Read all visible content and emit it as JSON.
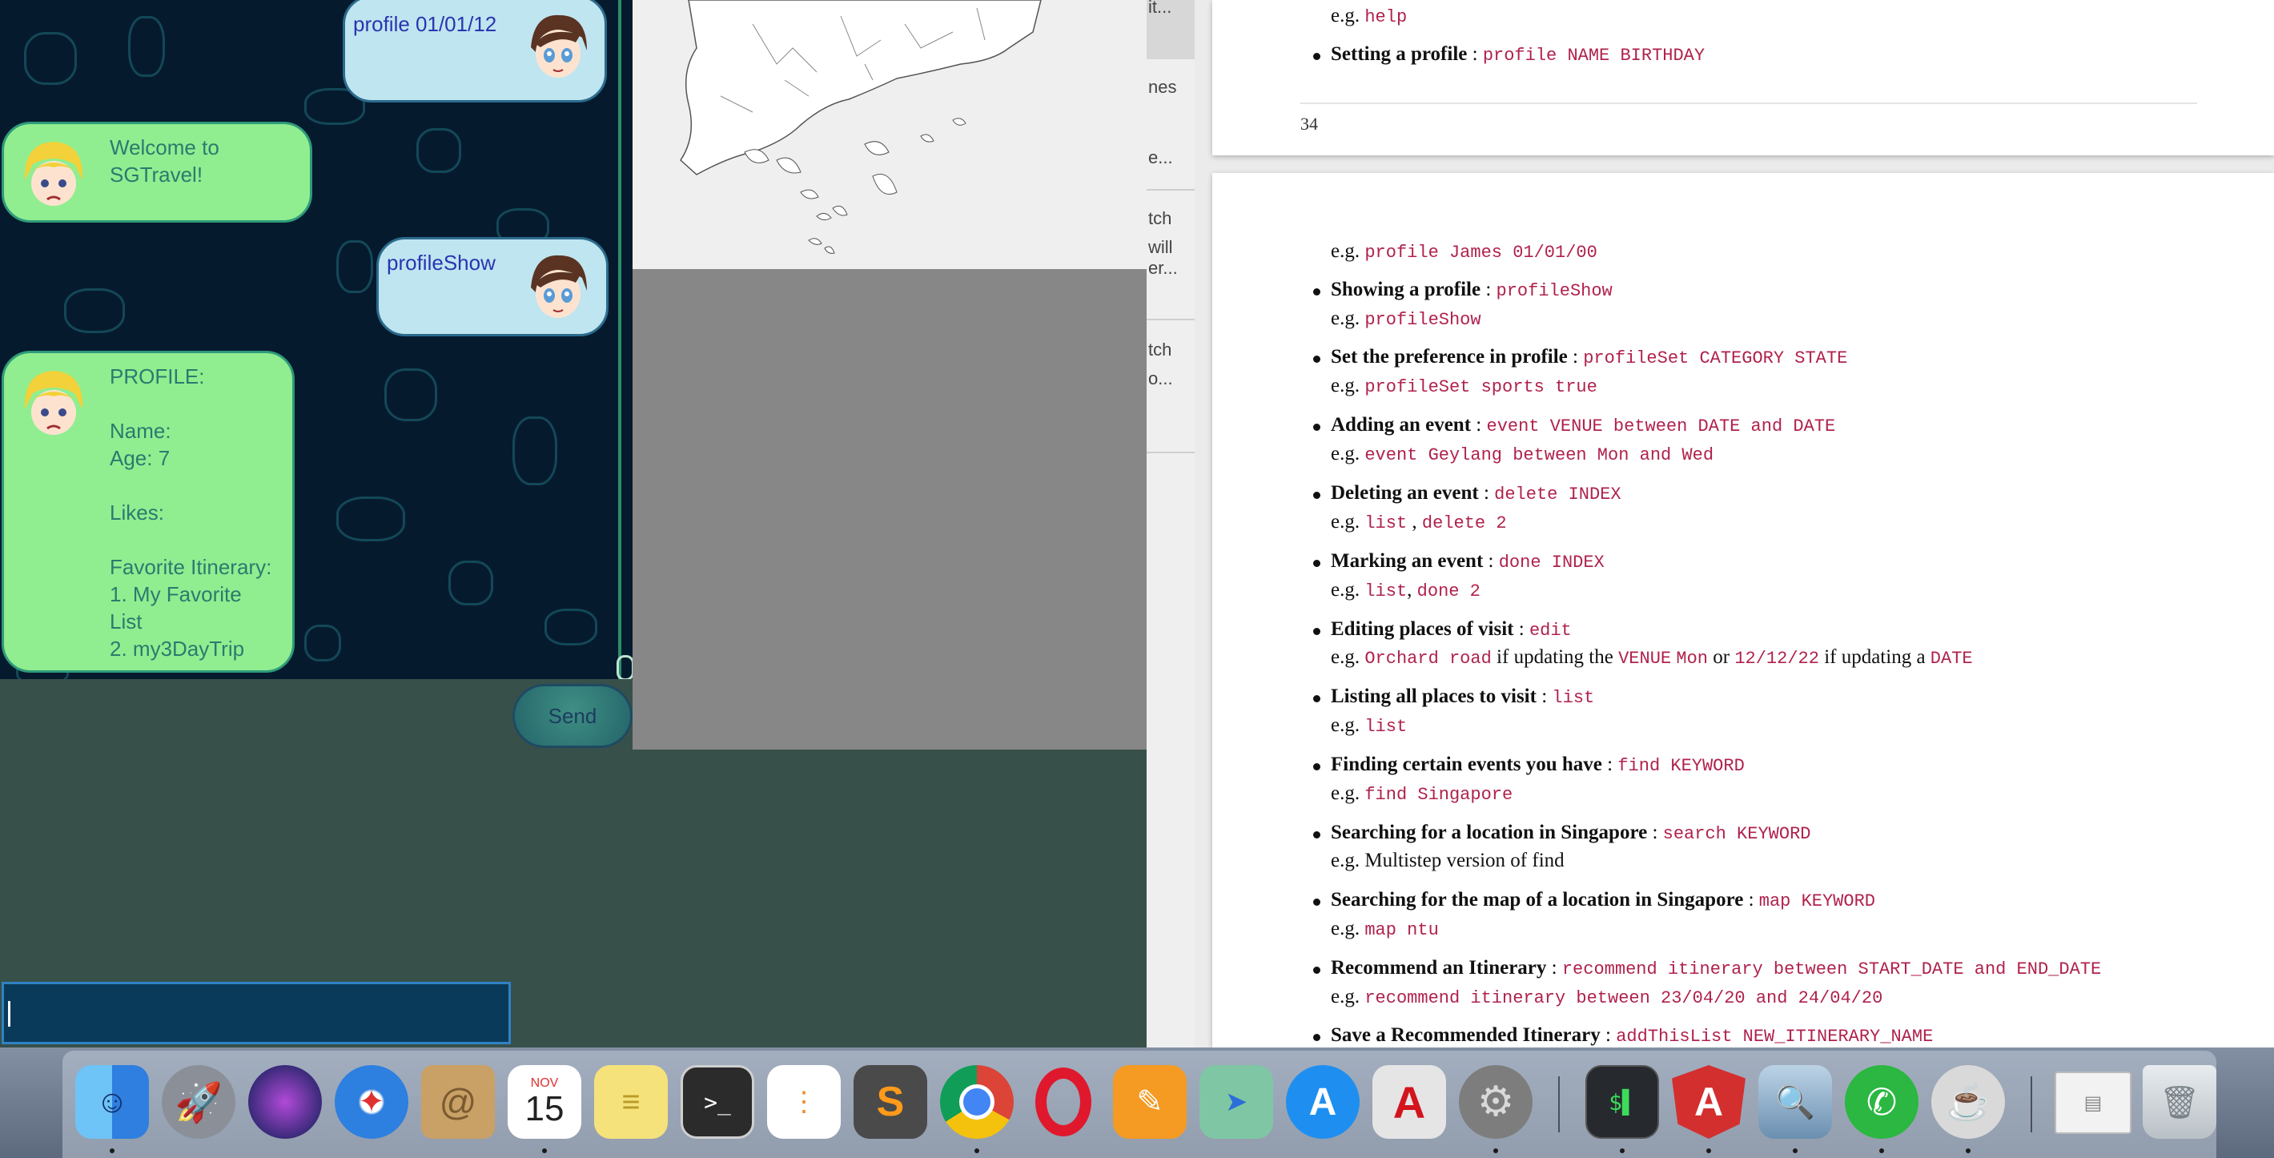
{
  "chat": {
    "messages": [
      {
        "role": "user",
        "text": "profile 01/01/12"
      },
      {
        "role": "bot",
        "text": "Welcome to\nSGTravel!"
      },
      {
        "role": "user",
        "text": "profileShow"
      },
      {
        "role": "bot",
        "text": "PROFILE:\n\nName:\nAge: 7\n\nLikes:\n\nFavorite Itinerary:\n1. My Favorite\nList\n2. my3DayTrip"
      }
    ],
    "send_label": "Send",
    "input_value": ""
  },
  "list_pane": {
    "fragments": [
      "it...",
      "nes",
      "e...",
      "tch",
      "will",
      "er...",
      "tch",
      "o..."
    ]
  },
  "pdf": {
    "page1": {
      "lines": [
        {
          "prefix": "e.g. ",
          "code": "help"
        },
        {
          "label": "Setting a profile",
          "sep": " : ",
          "code": "profile NAME BIRTHDAY"
        }
      ],
      "page_number": "34"
    },
    "page2": {
      "example0": {
        "prefix": "e.g. ",
        "code": "profile James 01/01/00"
      },
      "items": [
        {
          "label": "Showing a profile",
          "sep": " : ",
          "code": "profileShow",
          "example_prefix": "e.g. ",
          "example_code": "profileShow"
        },
        {
          "label": "Set the preference in profile",
          "sep": " : ",
          "code": "profileSet CATEGORY STATE",
          "example_prefix": "e.g. ",
          "example_code": "profileSet sports true"
        },
        {
          "label": "Adding an event",
          "sep": " : ",
          "code": "event VENUE between DATE and DATE",
          "example_prefix": "e.g. ",
          "example_code": "event Geylang between Mon and Wed"
        },
        {
          "label": "Deleting an event",
          "sep": " : ",
          "code": "delete INDEX",
          "example_prefix": "e.g. ",
          "example_code": "list",
          "example_mid": " , ",
          "example_code2": "delete 2"
        },
        {
          "label": "Marking an event",
          "sep": " : ",
          "code": "done INDEX",
          "example_prefix": "e.g. ",
          "example_code": "list",
          "example_mid": ", ",
          "example_code2": "done 2"
        },
        {
          "label": "Editing places of visit",
          "sep": " : ",
          "code": "edit",
          "example_prefix": "e.g. ",
          "example_code": "Orchard road",
          "example_mid": " if updating the ",
          "example_code2": "VENUE",
          "example_mid2": " ",
          "example_code3": "Mon",
          "example_mid3": " or ",
          "example_code4": "12/12/22",
          "example_mid4": " if updating a ",
          "example_code5": "DATE"
        },
        {
          "label": "Listing all places to visit",
          "sep": " : ",
          "code": "list",
          "example_prefix": "e.g. ",
          "example_code": "list"
        },
        {
          "label": "Finding certain events you have",
          "sep": " : ",
          "code": "find KEYWORD",
          "example_prefix": "e.g. ",
          "example_code": "find Singapore"
        },
        {
          "label": "Searching for a location in Singapore",
          "sep": " : ",
          "code": "search KEYWORD",
          "example_prefix": "e.g. ",
          "example_text": "Multistep version of find"
        },
        {
          "label": "Searching for the map of a location in Singapore",
          "sep": " : ",
          "code": "map KEYWORD",
          "example_prefix": "e.g. ",
          "example_code": "map ntu"
        },
        {
          "label": "Recommend an Itinerary",
          "sep": " : ",
          "code": "recommend itinerary between START_DATE and END_DATE",
          "example_prefix": "e.g. ",
          "example_code": "recommend itinerary between 23/04/20 and 24/04/20"
        },
        {
          "label": "Save a Recommended Itinerary",
          "sep": " : ",
          "code": "addThisList NEW_ITINERARY_NAME"
        }
      ]
    }
  },
  "dock": {
    "apps": [
      "finder-icon",
      "launchpad-icon",
      "siri-icon",
      "safari-icon",
      "contacts-icon",
      "calendar-icon",
      "notes-icon",
      "terminal-icon",
      "reminders-icon",
      "sublime-icon",
      "chrome-icon",
      "opera-icon",
      "pages-icon",
      "maps-icon",
      "app-store-icon",
      "acrobat-icon",
      "system-preferences-icon",
      "terminal2-icon",
      "angular-icon",
      "preview-icon",
      "whatsapp-icon",
      "script-editor-icon",
      "document-stack-icon",
      "trash-icon"
    ],
    "calendar_month": "NOV",
    "calendar_day": "15",
    "colors": {
      "finder": "#3b8fe8",
      "launchpad": "#8b8f98",
      "siri": "#3a2a7a",
      "safari": "#2d7fe0",
      "contacts": "#c9a065",
      "calendar": "#ffffff",
      "notes": "#f6e27a",
      "terminal": "#2b2b2b",
      "reminders": "#ffffff",
      "sublime": "#4a4a4a",
      "chrome": "#ffffff",
      "opera": "#e0182d",
      "pages": "#f59a23",
      "maps": "#7fc6a4",
      "appstore": "#1e8ff0",
      "acrobat": "#e5e5e5",
      "sysprefs": "#7d7d7d",
      "terminal2": "#262a2e",
      "angular": "#d32f2f",
      "preview": "#7aa6c8",
      "whatsapp": "#2bb741",
      "scripteditor": "#d9d9d9",
      "docstack": "#f2f2f2",
      "trash": "#cfd4d9"
    }
  }
}
